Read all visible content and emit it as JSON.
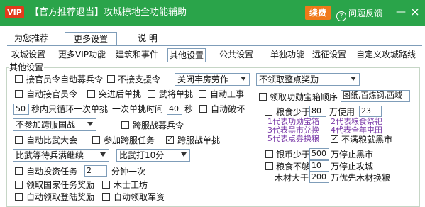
{
  "titlebar": {
    "vip": "VIP",
    "title": "【官方推荐退当】攻城掠地全功能辅助",
    "renew": "续费",
    "feedback": "问题反馈",
    "min": "—",
    "close": "×"
  },
  "main_tabs": [
    "为您推荐",
    "更多设置",
    "说 明"
  ],
  "sub_tabs": [
    "攻城设置",
    "更多VIP功能",
    "建筑和事件",
    "其他设置",
    "公共设置",
    "单独功能",
    "远征设置",
    "自定义攻城路线"
  ],
  "group_title": "其他设置",
  "left": {
    "c1": "接官员令自动募兵令",
    "c2": "不接支援令",
    "sel_labor": "关闭牢房劳作",
    "sel_reward": "不领取整点奖励",
    "c3": "自动接官员令",
    "c4": "突进后单挑",
    "c5": "武将单挑",
    "c6": "自动工事",
    "loop_val": "50",
    "loop_text": "秒内只循环一次单挑",
    "duel_text": "一次单挑时间",
    "duel_val": "40",
    "sec": "秒",
    "c7": "自动破坏",
    "sel_cross": "不参加跨服国战",
    "c8": "跨服战募兵令",
    "c9": "自动比武大会",
    "c10": "参加跨服任务",
    "c11": "跨服战单挑",
    "sel_contest": "比武等待兵满继续",
    "sel_contest2": "比武打10分",
    "c12": "自动投资任务",
    "invest_val": "2",
    "invest_text": "分钟一次",
    "c13": "领取国家任务奖励",
    "c14": "木士工坊",
    "c15": "自动领取登陆奖励",
    "c16": "自动领取军资"
  },
  "right": {
    "c_gift": "领取功勋宝箱顺序",
    "gift_order": "图纸,百炼钢,西域",
    "c_food": "粮食少于",
    "food_val": "80",
    "food_text": "万使用",
    "food_n": "23",
    "opt1": "1代表功勋宝箱",
    "opt2": "2代表粮食祭祀",
    "opt3": "3代表黑市兑换",
    "opt4": "4代表全年屯田",
    "opt5": "5代表点券换粮",
    "c_no": "不满粮就黑市",
    "c_silver": "银币少于",
    "silver_val": "500",
    "silver_text": "万停止黑市",
    "c_grain": "粮食不够",
    "grain_val": "10",
    "grain_text": "万停止攻城",
    "wood_text": "木材大于",
    "wood_val": "200",
    "wood_text2": "万优先木材换粮"
  }
}
